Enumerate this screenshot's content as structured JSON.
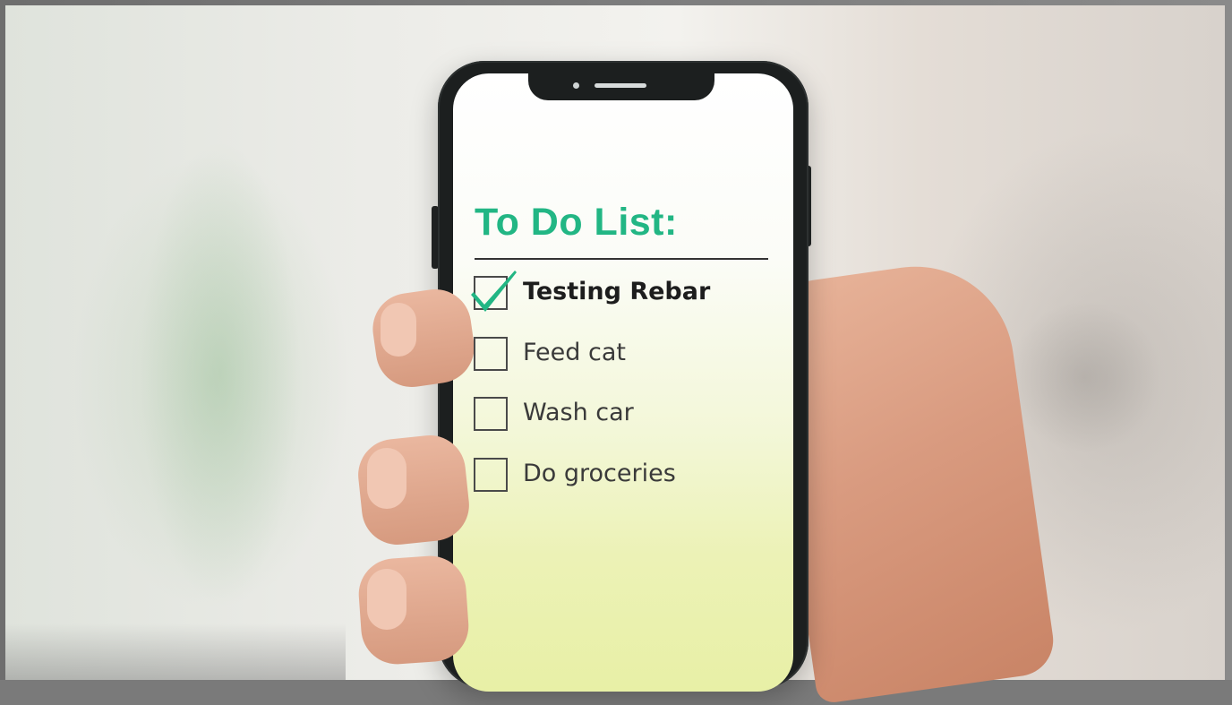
{
  "todo": {
    "title": "To Do List:",
    "items": [
      {
        "label": "Testing Rebar",
        "checked": true
      },
      {
        "label": "Feed cat",
        "checked": false
      },
      {
        "label": "Wash car",
        "checked": false
      },
      {
        "label": "Do groceries",
        "checked": false
      }
    ]
  },
  "colors": {
    "accent": "#22b684",
    "text": "#3a3a3a",
    "phone_body": "#1c1f1f"
  },
  "icons": {
    "check": "checkmark-icon",
    "checkbox": "checkbox-icon"
  }
}
